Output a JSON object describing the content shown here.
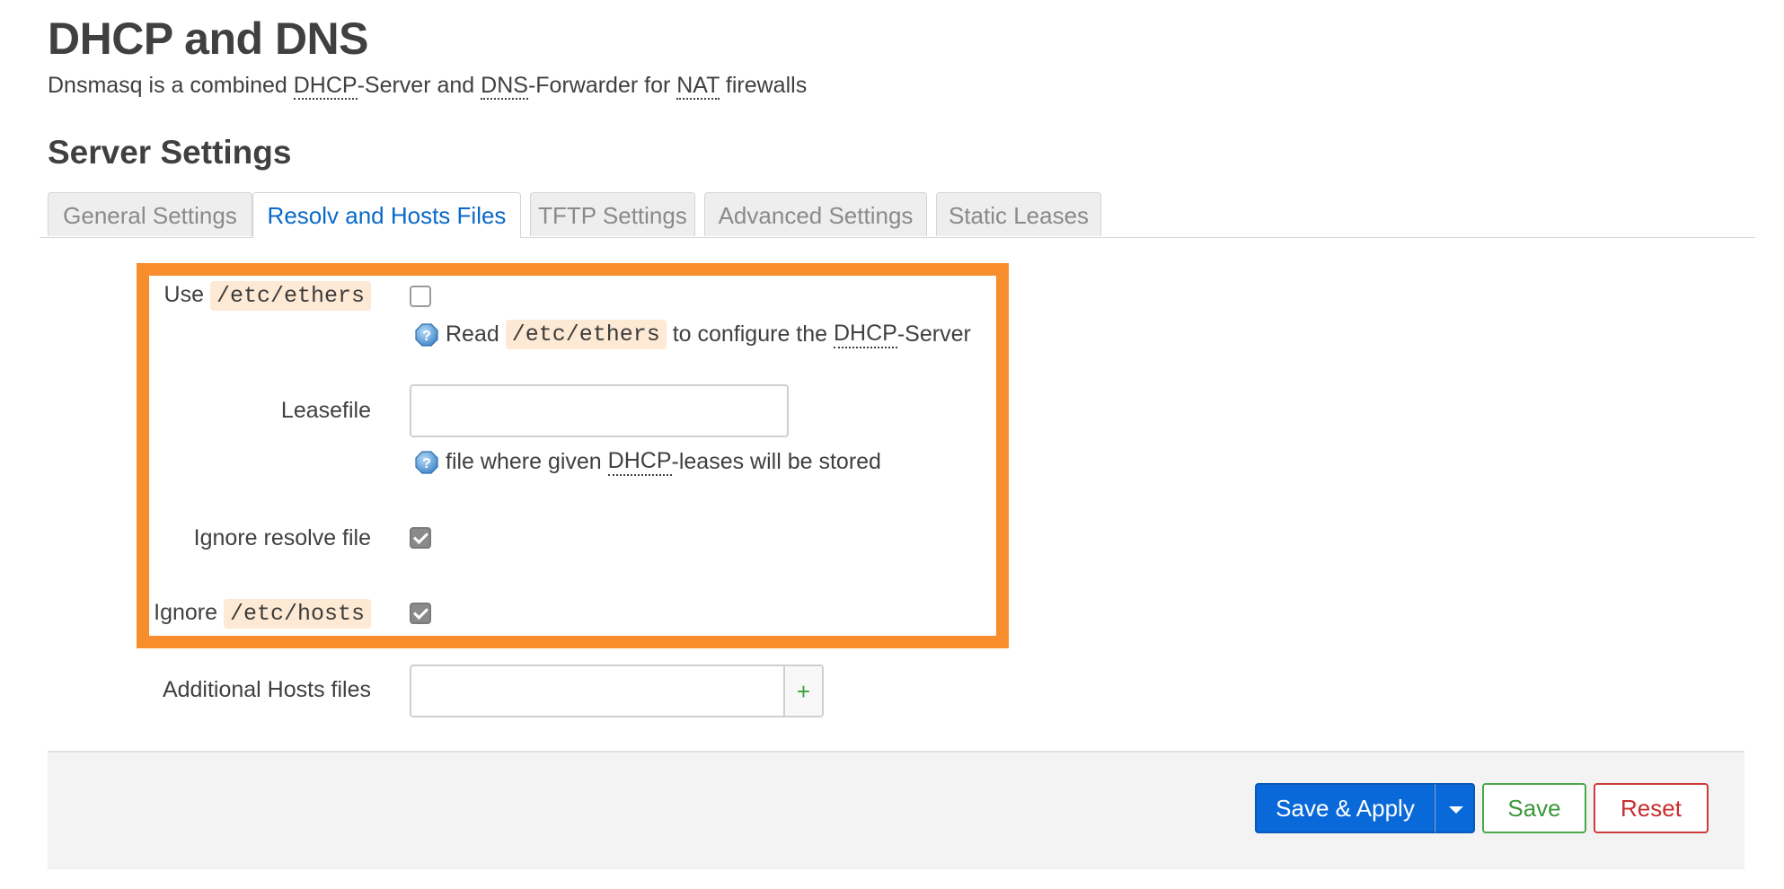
{
  "header": {
    "title": "DHCP and DNS",
    "desc_prefix": "Dnsmasq is a combined ",
    "desc_abbr1": "DHCP",
    "desc_mid1": "-Server and ",
    "desc_abbr2": "DNS",
    "desc_mid2": "-Forwarder for ",
    "desc_abbr3": "NAT",
    "desc_suffix": " firewalls"
  },
  "section": {
    "title": "Server Settings"
  },
  "tabs": [
    {
      "label": "General Settings",
      "active": false
    },
    {
      "label": "Resolv and Hosts Files",
      "active": true
    },
    {
      "label": "TFTP Settings",
      "active": false
    },
    {
      "label": "Advanced Settings",
      "active": false
    },
    {
      "label": "Static Leases",
      "active": false
    }
  ],
  "form": {
    "use_ethers": {
      "label_prefix": "Use",
      "label_code": "/etc/ethers",
      "checked": false,
      "help_prefix": "Read",
      "help_code": "/etc/ethers",
      "help_mid": "to configure the",
      "help_abbr": "DHCP",
      "help_suffix": "-Server"
    },
    "leasefile": {
      "label": "Leasefile",
      "value": "",
      "help_prefix": "file where given",
      "help_abbr": "DHCP",
      "help_suffix": "-leases will be stored"
    },
    "ignore_resolve": {
      "label": "Ignore resolve file",
      "checked": true
    },
    "ignore_hosts": {
      "label_prefix": "Ignore",
      "label_code": "/etc/hosts",
      "checked": true
    },
    "additional_hosts": {
      "label": "Additional Hosts files",
      "value": "",
      "add_symbol": "+"
    }
  },
  "actions": {
    "save_apply": "Save & Apply",
    "save": "Save",
    "reset": "Reset"
  },
  "colors": {
    "highlight": "#f78d2d",
    "primary": "#0a69d8",
    "save": "#3a983a",
    "reset": "#c82e2e",
    "active_tab": "#0a69c8"
  }
}
